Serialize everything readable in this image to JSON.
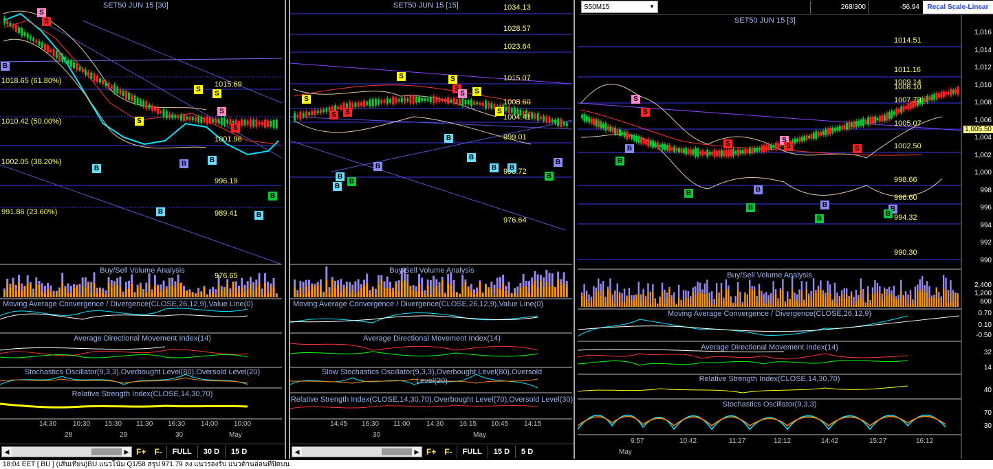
{
  "panes": [
    {
      "title": "SET50 JUN 15  [30]",
      "price_labels": [
        "1018.65 (61.80%)",
        "1015.69",
        "1010.42 (50.00%)",
        "1002.05 (38.20%)",
        "996.19",
        "991.86 (23.60%)",
        "989.41",
        "976.65",
        "1001.96"
      ],
      "volume_title": "Buy/Sell Volume Analysis",
      "macd_title": "Moving Average Convergence / Divergence(CLOSE,26,12,9),Value Line(0)",
      "adx_title": "Average Directional Movement Index(14)",
      "stoch_title": "Stochastics Oscillator(9,3,3),Overbought Level(80),Oversold Level(20)",
      "rsi_title": "Relative Strength Index(CLOSE,14,30,70)",
      "time_labels": [
        "14:30",
        "10:30",
        "15:30",
        "11:30",
        "16:30",
        "14:00",
        "10:00"
      ],
      "date_labels": [
        "28",
        "29",
        "30",
        "May"
      ],
      "toolbar": [
        "F+",
        "F-",
        "FULL",
        "30 D",
        "15 D"
      ]
    },
    {
      "title": "SET50 JUN 15  [15]",
      "price_labels": [
        "1034.13",
        "1028.57",
        "1023.64",
        "1015.07",
        "1008.60",
        "1004.41",
        "999.01",
        "993.72",
        "976.64"
      ],
      "volume_title": "Buy/Sell Volume Analysis",
      "macd_title": "Moving Average Convergence / Divergence(CLOSE,26,12,9),Value Line(0)",
      "adx_title": "Average Directional Movement Index(14)",
      "stoch_title": "Slow Stochastics Oscillator(9,3,3),Overbought Level(80),Oversold Level(20)",
      "rsi_title": "Relative Strength Index(CLOSE,14,30,70),Overbought Level(70),Oversold Level(30)",
      "time_labels": [
        "14:45",
        "16:30",
        "11:00",
        "14:30",
        "16:15",
        "10:45",
        "14:15"
      ],
      "date_labels": [
        "30",
        "May"
      ],
      "toolbar": [
        "F+",
        "F-",
        "FULL",
        "15 D",
        "5 D"
      ]
    },
    {
      "title": "SET50 JUN 15  [3]",
      "price_labels": [
        "1014.51",
        "1011.16",
        "1009.14",
        "1008.10",
        "1007.73",
        "1005.07",
        "1002.50",
        "998.66",
        "996.60",
        "994.32",
        "990.30"
      ],
      "current_price": "1,005.50",
      "scale": [
        "1,016",
        "1,014",
        "1,012",
        "1,010",
        "1,008",
        "1,006",
        "1,004",
        "1,002",
        "1,000",
        "998",
        "996",
        "994",
        "992",
        "990"
      ],
      "volume_title": "Buy/Sell Volume Analysis",
      "volume_scale": [
        "2,400",
        "1,200",
        "600"
      ],
      "macd_title": "Moving Average Convergence / Divergence(CLOSE,26,12,9)",
      "macd_scale": [
        "0.70",
        "0.10",
        "-0.50"
      ],
      "adx_title": "Average Directional Movement Index(14)",
      "adx_scale": [
        "32",
        "14"
      ],
      "rsi_title": "Relative Strength Index(CLOSE,14,30,70)",
      "rsi_scale": [
        "40"
      ],
      "stoch_title": "Stochastics Oscillator(9,3,3)",
      "stoch_scale": [
        "70",
        "30"
      ],
      "time_labels": [
        "9:57",
        "10:42",
        "11:27",
        "12:12",
        "14:42",
        "15:27",
        "16:12"
      ],
      "date_labels": [
        "May"
      ]
    }
  ],
  "topbar": {
    "symbol": "S50M15",
    "count": "268/300",
    "change": "-56.94",
    "recal": "Recal Scale-Linear"
  },
  "status": "18:04  EET  [ BU ]  (เส้นเทียน)BU แนวโน้ม Q1/58 สรุป 971.79 ลง แนวรองรับ แนวต้านอ่อนที่ปิดบน",
  "colors": {
    "buy": "#00cc33",
    "sell": "#ff2222",
    "signal_b": "#66ddff",
    "signal_s": "#ffff00"
  }
}
